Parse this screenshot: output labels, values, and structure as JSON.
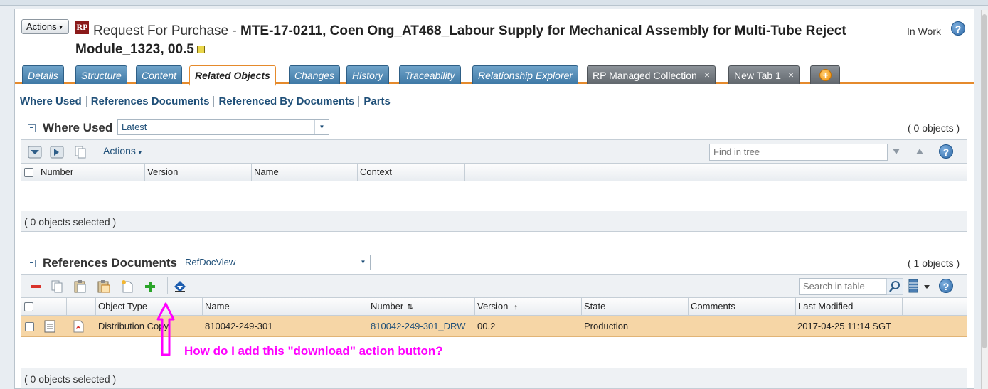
{
  "header": {
    "actions_label": "Actions",
    "rp_badge": "RP",
    "type_label": "Request For Purchase -",
    "title_bold": "MTE-17-0211, Coen Ong_AT468_Labour Supply for Mechanical Assembly for Multi-Tube Reject",
    "title_line2": "Module_1323, 00.5",
    "status": "In Work",
    "help": "?"
  },
  "tabs": [
    {
      "label": "Details"
    },
    {
      "label": "Structure"
    },
    {
      "label": "Content"
    },
    {
      "label": "Related Objects"
    },
    {
      "label": "Changes"
    },
    {
      "label": "History"
    },
    {
      "label": "Traceability"
    },
    {
      "label": "Relationship Explorer"
    },
    {
      "label": "RP Managed Collection"
    },
    {
      "label": "New Tab 1"
    }
  ],
  "subnav": [
    "Where Used",
    "References Documents",
    "Referenced By Documents",
    "Parts"
  ],
  "where_used": {
    "title": "Where Used",
    "view": "Latest",
    "count": "( 0 objects )",
    "actions_label": "Actions",
    "find_placeholder": "Find in tree",
    "columns": [
      "Number",
      "Version",
      "Name",
      "Context"
    ],
    "footer": "( 0 objects selected )"
  },
  "ref_docs": {
    "title": "References Documents",
    "view": "RefDocView",
    "count": "( 1 objects )",
    "search_placeholder": "Search in table",
    "columns": [
      "Object Type",
      "Name",
      "Number",
      "Version",
      "State",
      "Comments",
      "Last Modified"
    ],
    "rows": [
      {
        "object_type": "Distribution Copy",
        "name": "810042-249-301",
        "number": "810042-249-301_DRW",
        "version": "00.2",
        "state": "Production",
        "comments": "",
        "last_modified": "2017-04-25 11:14 SGT"
      }
    ],
    "footer": "( 0 objects selected )"
  },
  "annotation": {
    "text": "How do I add this \"download\" action button?",
    "color": "#ff00ff"
  },
  "colors": {
    "tab_blue": "#3f79a6",
    "tab_accent": "#e58a2c",
    "row_highlight": "#f6d6a6",
    "link": "#1f4f78"
  }
}
